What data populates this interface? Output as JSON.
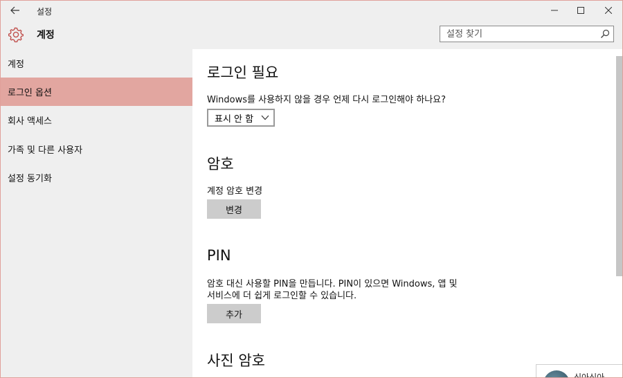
{
  "window": {
    "title": "설정"
  },
  "header": {
    "title": "계정",
    "search_placeholder": "설정 찾기"
  },
  "sidebar": {
    "items": [
      {
        "label": "계정",
        "selected": false
      },
      {
        "label": "로그인 옵션",
        "selected": true
      },
      {
        "label": "회사 액세스",
        "selected": false
      },
      {
        "label": "가족 및 다른 사용자",
        "selected": false
      },
      {
        "label": "설정 동기화",
        "selected": false
      }
    ]
  },
  "main": {
    "signin_required": {
      "title": "로그인 필요",
      "question": "Windows를 사용하지 않을 경우 언제 다시 로그인해야 하나요?",
      "dropdown_value": "표시 안 함"
    },
    "password": {
      "title": "암호",
      "description": "계정 암호 변경",
      "button": "변경"
    },
    "pin": {
      "title": "PIN",
      "description_line1": "암호 대신 사용할 PIN을 만듭니다. PIN이 있으면 Windows, 앱 및",
      "description_line2": "서비스에 더 쉽게 로그인할 수 있습니다.",
      "button": "추가"
    },
    "picture_password": {
      "title": "사진 암호"
    }
  },
  "notification": {
    "text": "신아신아"
  },
  "colors": {
    "accent": "#c0504d",
    "selected_bg": "#e2a6a0",
    "chrome_bg": "#efefef",
    "button_bg": "#cccccc"
  }
}
